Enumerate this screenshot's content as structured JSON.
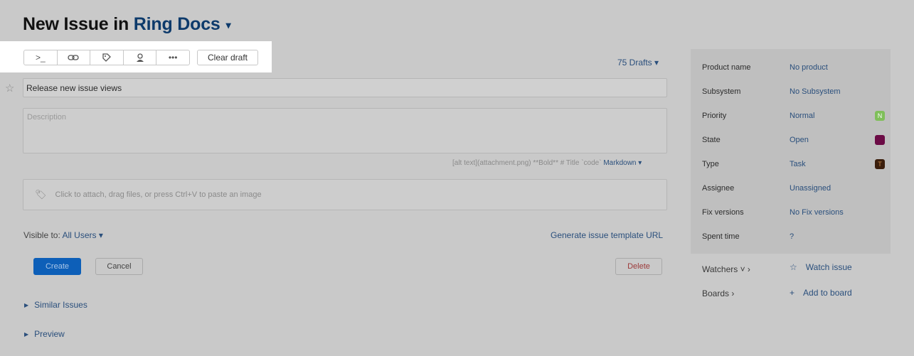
{
  "header": {
    "title_prefix": "New Issue in",
    "project": "Ring Docs"
  },
  "toolbar": {
    "command_icon": ">_",
    "link_icon": "⊂⊃",
    "tag_icon": "◇",
    "assignee_icon": "●",
    "more_icon": "•••",
    "clear_draft_label": "Clear draft"
  },
  "drafts": {
    "label": "75 Drafts"
  },
  "form": {
    "summary_value": "Release new issue views",
    "description_placeholder": "Description",
    "markdown_hint": "[alt text](attachment.png) **Bold** # Title `code`",
    "markdown_label": "Markdown",
    "attach_text": "Click to attach, drag files, or press Ctrl+V to paste an image",
    "visible_label": "Visible to:",
    "visible_value": "All Users",
    "template_url_label": "Generate issue template URL"
  },
  "buttons": {
    "create": "Create",
    "cancel": "Cancel",
    "delete": "Delete"
  },
  "links": {
    "similar": "Similar Issues",
    "preview": "Preview"
  },
  "fields": [
    {
      "name": "Product name",
      "value": "No product"
    },
    {
      "name": "Subsystem",
      "value": "No Subsystem"
    },
    {
      "name": "Priority",
      "value": "Normal",
      "chip": "N"
    },
    {
      "name": "State",
      "value": "Open"
    },
    {
      "name": "Type",
      "value": "Task",
      "chip": "T"
    },
    {
      "name": "Assignee",
      "value": "Unassigned"
    },
    {
      "name": "Fix versions",
      "value": "No Fix versions"
    },
    {
      "name": "Spent time",
      "value": "?"
    }
  ],
  "side": {
    "watchers_label": "Watchers",
    "watch_issue": "Watch issue",
    "boards_label": "Boards",
    "add_to_board": "Add to board"
  },
  "colors": {
    "priority_normal": "#7fbf5a",
    "state_open": "#6b0b45",
    "type_task": "#3b1e0c",
    "primary": "#0d5fb8"
  }
}
